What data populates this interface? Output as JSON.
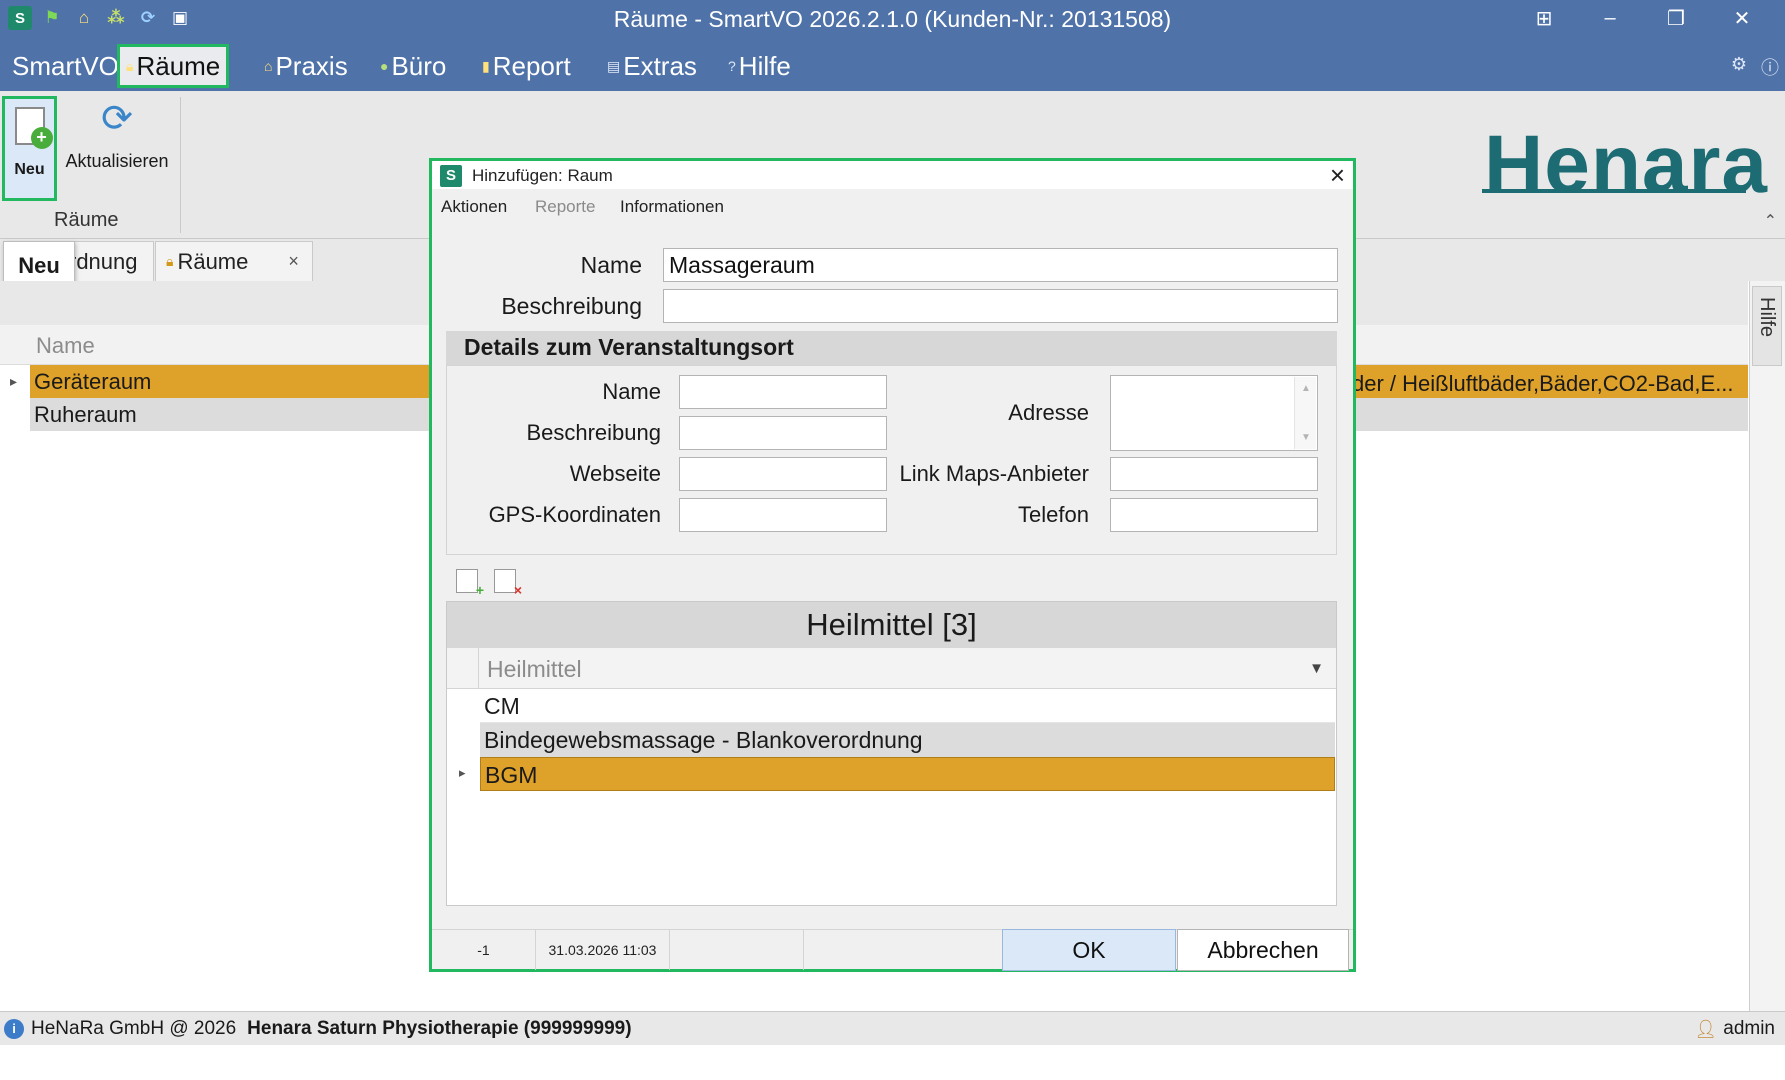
{
  "app": {
    "title": "Räume - SmartVO 2026.2.1.0 (Kunden-Nr.: 20131508)",
    "quick_access_icons": [
      "smartvo-logo-icon",
      "flag-icon",
      "home-icon",
      "network-icon",
      "refresh-icon",
      "calendar-icon"
    ],
    "logo_letter": "S"
  },
  "menu": {
    "items": [
      "SmartVO",
      "Räume",
      "Praxis",
      "Büro",
      "Report",
      "Extras",
      "Hilfe"
    ],
    "active": "Räume"
  },
  "ribbon": {
    "neu_label": "Neu",
    "aktualisieren_label": "Aktualisieren",
    "group_label": "Räume",
    "brand": "Henara"
  },
  "tooltip": {
    "text": "Neu"
  },
  "tabs": [
    {
      "label": "rdnung"
    },
    {
      "label": "Räume"
    }
  ],
  "grid": {
    "column_header": "Name",
    "rows": [
      "Geräteraum",
      "Ruheraum"
    ],
    "selected_row_extra": "der / Heißluftbäder,Bäder,CO2-Bad,E..."
  },
  "side_panel": {
    "label": "Hilfe"
  },
  "statusbar": {
    "copyright": "HeNaRa GmbH @ 2026",
    "practice": "Henara Saturn Physiotherapie (999999999)",
    "user": "admin"
  },
  "dialog": {
    "title": "Hinzufügen: Raum",
    "menus": {
      "aktionen": "Aktionen",
      "reporte": "Reporte",
      "informationen": "Informationen"
    },
    "name_label": "Name",
    "name_value": "Massageraum",
    "beschreibung_label": "Beschreibung",
    "beschreibung_value": "",
    "details": {
      "header": "Details zum Veranstaltungsort",
      "name_label": "Name",
      "beschreibung_label": "Beschreibung",
      "webseite_label": "Webseite",
      "gps_label": "GPS-Koordinaten",
      "adresse_label": "Adresse",
      "link_maps_label": "Link Maps-Anbieter",
      "telefon_label": "Telefon"
    },
    "heilmittel": {
      "title": "Heilmittel [3]",
      "column_header": "Heilmittel",
      "rows": [
        "CM",
        "Bindegewebsmassage - Blankoverordnung",
        "BGM"
      ]
    },
    "status": {
      "id": "-1",
      "timestamp": "31.03.2026 11:03"
    },
    "ok_label": "OK",
    "cancel_label": "Abbrechen"
  },
  "colors": {
    "titlebar": "#4f72a8",
    "highlight_green": "#22b860",
    "selection": "#dea129",
    "brand": "#1d6b73"
  }
}
